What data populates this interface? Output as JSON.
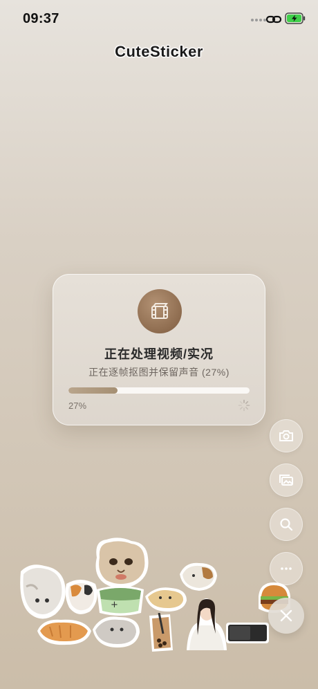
{
  "status_bar": {
    "time": "09:37"
  },
  "app": {
    "title": "CuteSticker"
  },
  "processing": {
    "title": "正在处理视频/实况",
    "subtitle": "正在逐帧抠图并保留声音 (27%)",
    "progress": 0.27,
    "progress_label": "27%"
  },
  "fab_buttons": [
    {
      "icon": "camera-icon"
    },
    {
      "icon": "gallery-icon"
    },
    {
      "icon": "search-icon"
    },
    {
      "icon": "more-icon"
    },
    {
      "icon": "close-icon"
    }
  ],
  "colors": {
    "accent_brown": "#8e6c4f",
    "progress_fill": "#b09a7e",
    "battery_green": "#3fcf4a"
  }
}
